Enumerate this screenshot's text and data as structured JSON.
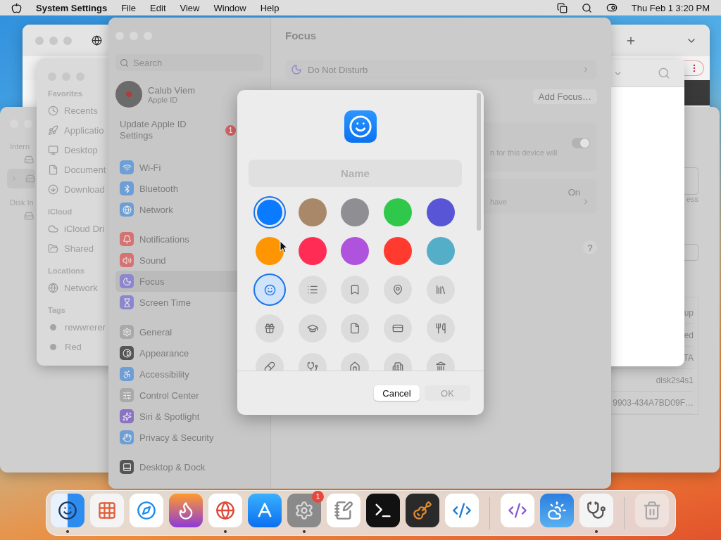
{
  "menu_bar": {
    "app_name": "System Settings",
    "menus": [
      "File",
      "Edit",
      "View",
      "Window",
      "Help"
    ],
    "clock": "Thu Feb 1  3:20 PM"
  },
  "disk_window": {
    "sidebar_labels": [
      "Intern",
      "Disk In"
    ],
    "detail_label": "ess",
    "rows": [
      "up",
      "ed",
      "TA",
      "disk2s4s1",
      "9903-434A7BD09F…"
    ]
  },
  "finder_window": {
    "sections": [
      {
        "title": "Favorites",
        "items": [
          {
            "label": "Recents",
            "kind": "place"
          },
          {
            "label": "Applicatio",
            "kind": "place"
          },
          {
            "label": "Desktop",
            "kind": "place"
          },
          {
            "label": "Document",
            "kind": "place"
          },
          {
            "label": "Download",
            "kind": "place"
          }
        ]
      },
      {
        "title": "iCloud",
        "items": [
          {
            "label": "iCloud Dri",
            "kind": "place"
          },
          {
            "label": "Shared",
            "kind": "place"
          }
        ]
      },
      {
        "title": "Locations",
        "items": [
          {
            "label": "Network",
            "kind": "place"
          }
        ]
      },
      {
        "title": "Tags",
        "items": [
          {
            "label": "rewwrerer",
            "kind": "tag"
          },
          {
            "label": "Red",
            "kind": "tag"
          }
        ]
      }
    ]
  },
  "settings_window": {
    "title": "Focus",
    "search_placeholder": "Search",
    "account": {
      "name": "Calub Viem",
      "subtitle": "Apple ID"
    },
    "update": {
      "label": "Update Apple ID Settings",
      "badge": "1"
    },
    "groups": [
      [
        {
          "label": "Wi-Fi",
          "color": "#6d9fd6",
          "selected": false
        },
        {
          "label": "Bluetooth",
          "color": "#6d9fd6",
          "selected": false
        },
        {
          "label": "Network",
          "color": "#6d9fd6",
          "selected": false
        }
      ],
      [
        {
          "label": "Notifications",
          "color": "#d57272",
          "selected": false
        },
        {
          "label": "Sound",
          "color": "#d57272",
          "selected": false
        },
        {
          "label": "Focus",
          "color": "#8c86cf",
          "selected": true
        },
        {
          "label": "Screen Time",
          "color": "#8c86cf",
          "selected": false
        }
      ],
      [
        {
          "label": "General",
          "color": "#a9a9a9",
          "selected": false
        },
        {
          "label": "Appearance",
          "color": "#555555",
          "selected": false
        },
        {
          "label": "Accessibility",
          "color": "#6d9fd6",
          "selected": false
        },
        {
          "label": "Control Center",
          "color": "#a9a9a9",
          "selected": false
        },
        {
          "label": "Siri & Spotlight",
          "color": "#8a72c4",
          "selected": false
        },
        {
          "label": "Privacy & Security",
          "color": "#6d9fd6",
          "selected": false
        }
      ],
      [
        {
          "label": "Desktop & Dock",
          "color": "#555555",
          "selected": false
        }
      ]
    ],
    "focus_item": "Do Not Disturb",
    "add_button": "Add Focus…",
    "share_text": "n for this device will",
    "share_on": true,
    "status": "On",
    "status_text": "have",
    "help": "?"
  },
  "modal": {
    "name_placeholder": "Name",
    "colors": [
      {
        "color": "#0a7aff",
        "selected": true
      },
      {
        "color": "#a88868",
        "selected": false
      },
      {
        "color": "#8e8e93",
        "selected": false
      },
      {
        "color": "#30c84a",
        "selected": false
      },
      {
        "color": "#5856d6",
        "selected": false
      },
      {
        "color": "#ff9500",
        "selected": false
      },
      {
        "color": "#ff2d55",
        "selected": false
      },
      {
        "color": "#af52de",
        "selected": false
      },
      {
        "color": "#ff3b30",
        "selected": false
      },
      {
        "color": "#55aec8",
        "selected": false
      }
    ],
    "symbols": [
      {
        "selected": true
      },
      {
        "selected": false
      },
      {
        "selected": false
      },
      {
        "selected": false
      },
      {
        "selected": false
      },
      {
        "selected": false
      },
      {
        "selected": false
      },
      {
        "selected": false
      },
      {
        "selected": false
      },
      {
        "selected": false
      },
      {
        "selected": false
      },
      {
        "selected": false
      },
      {
        "selected": false
      },
      {
        "selected": false
      },
      {
        "selected": false
      }
    ],
    "buttons": [
      {
        "label": "Cancel",
        "disabled": false
      },
      {
        "label": "OK",
        "disabled": true
      }
    ]
  },
  "dock": {
    "sections": [
      [
        {
          "running": true
        },
        {
          "running": false
        },
        {
          "running": false
        },
        {
          "running": false
        },
        {
          "running": true
        },
        {
          "running": false
        },
        {
          "running": true,
          "badge": "1"
        },
        {
          "running": false
        },
        {
          "running": false
        },
        {
          "running": false
        },
        {
          "running": false
        }
      ],
      [
        {
          "running": false
        },
        {
          "running": false
        },
        {
          "running": true
        }
      ],
      [
        {
          "running": false
        }
      ]
    ]
  }
}
